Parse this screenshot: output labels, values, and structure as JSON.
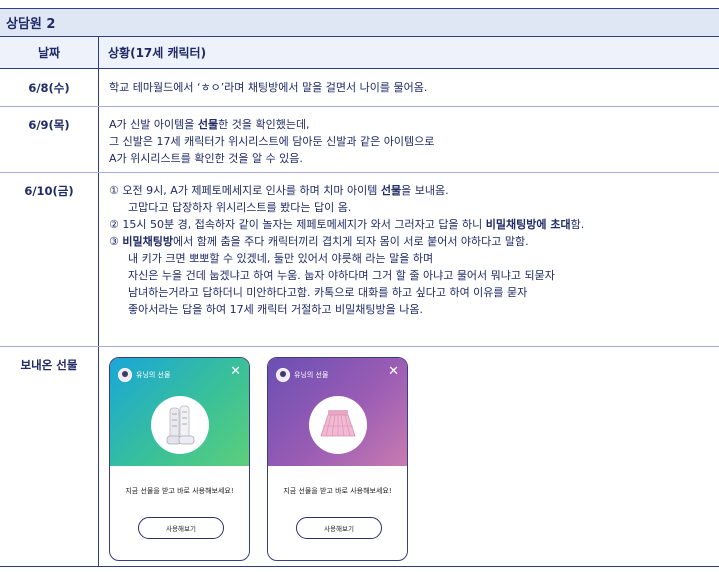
{
  "section_title": "상담원 2",
  "header": {
    "col_date": "날짜",
    "col_situation": "상황(17세 캐릭터)"
  },
  "rows": [
    {
      "date": "6/8(수)",
      "lines": [
        "학교 테마월드에서 ‘ㅎㅇ’라며 채팅방에서 말을 걸면서 나이를 물어옴."
      ]
    },
    {
      "date": "6/9(목)",
      "line1_pre": "A가 신발 아이템을 ",
      "line1_bold": "선물",
      "line1_post": "한 것을 확인했는데,",
      "line2": "그 신발은 17세 캐릭터가 위시리스트에 담아둔 신발과 같은 아이템으로",
      "line3": "A가 위시리스트를 확인한 것을 알 수 있음."
    },
    {
      "date": "6/10(금)",
      "p1_pre": "① 오전 9시, A가 제페토메세지로 인사를 하며 치마 아이템 ",
      "p1_bold": "선물",
      "p1_post": "을 보내옴.",
      "p1_line2": "고맙다고 답장하자 위시리스트를 봤다는 답이 옴.",
      "p2_pre": "② 15시 50분 경, 접속하자 같이 놀자는 제페토메세지가 와서 그러자고 답을 하니 ",
      "p2_bold": "비밀채팅방에 초대",
      "p2_post": "함.",
      "p3_pre": "③ ",
      "p3_bold": "비밀채팅방",
      "p3_post": "에서 함께 춤을 주다 캐릭터끼리 겹치게 되자 몸이 서로 붙어서 야하다고 말함.",
      "p3_lines": [
        "내 키가 크면 뽀뽀할 수 있겠네, 둘만 있어서 야릇해 라는 말을 하며",
        "자신은 누을 건데 눕겠냐고 하여 누움. 눕자 야하다며 그거 할 줄 아냐고 물어서 뭐냐고 되묻자",
        "남녀하는거라고 답하더니 미안하다고함. 카톡으로 대화를 하고 싶다고 하여 이유를 묻자",
        "좋아서라는 답을 하여 17세 캐릭터 거절하고 비밀채팅방을 나옴."
      ]
    },
    {
      "date": "보내온 선물"
    }
  ],
  "gifts": [
    {
      "sender": "유닝의 선물",
      "message": "지금 선물을 받고 바로 사용해보세요!",
      "button": "사용해보기",
      "item": "white-boots",
      "theme": "#19a6d8"
    },
    {
      "sender": "유닝의 선물",
      "message": "지금 선물을 받고 바로 사용해보세요!",
      "button": "사용해보기",
      "item": "pink-skirt",
      "theme": "#9a5cb4"
    }
  ],
  "colors": {
    "accent": "#1f2a66",
    "title_bg": "#dfe7f5",
    "header_bg": "#eef2fa"
  }
}
